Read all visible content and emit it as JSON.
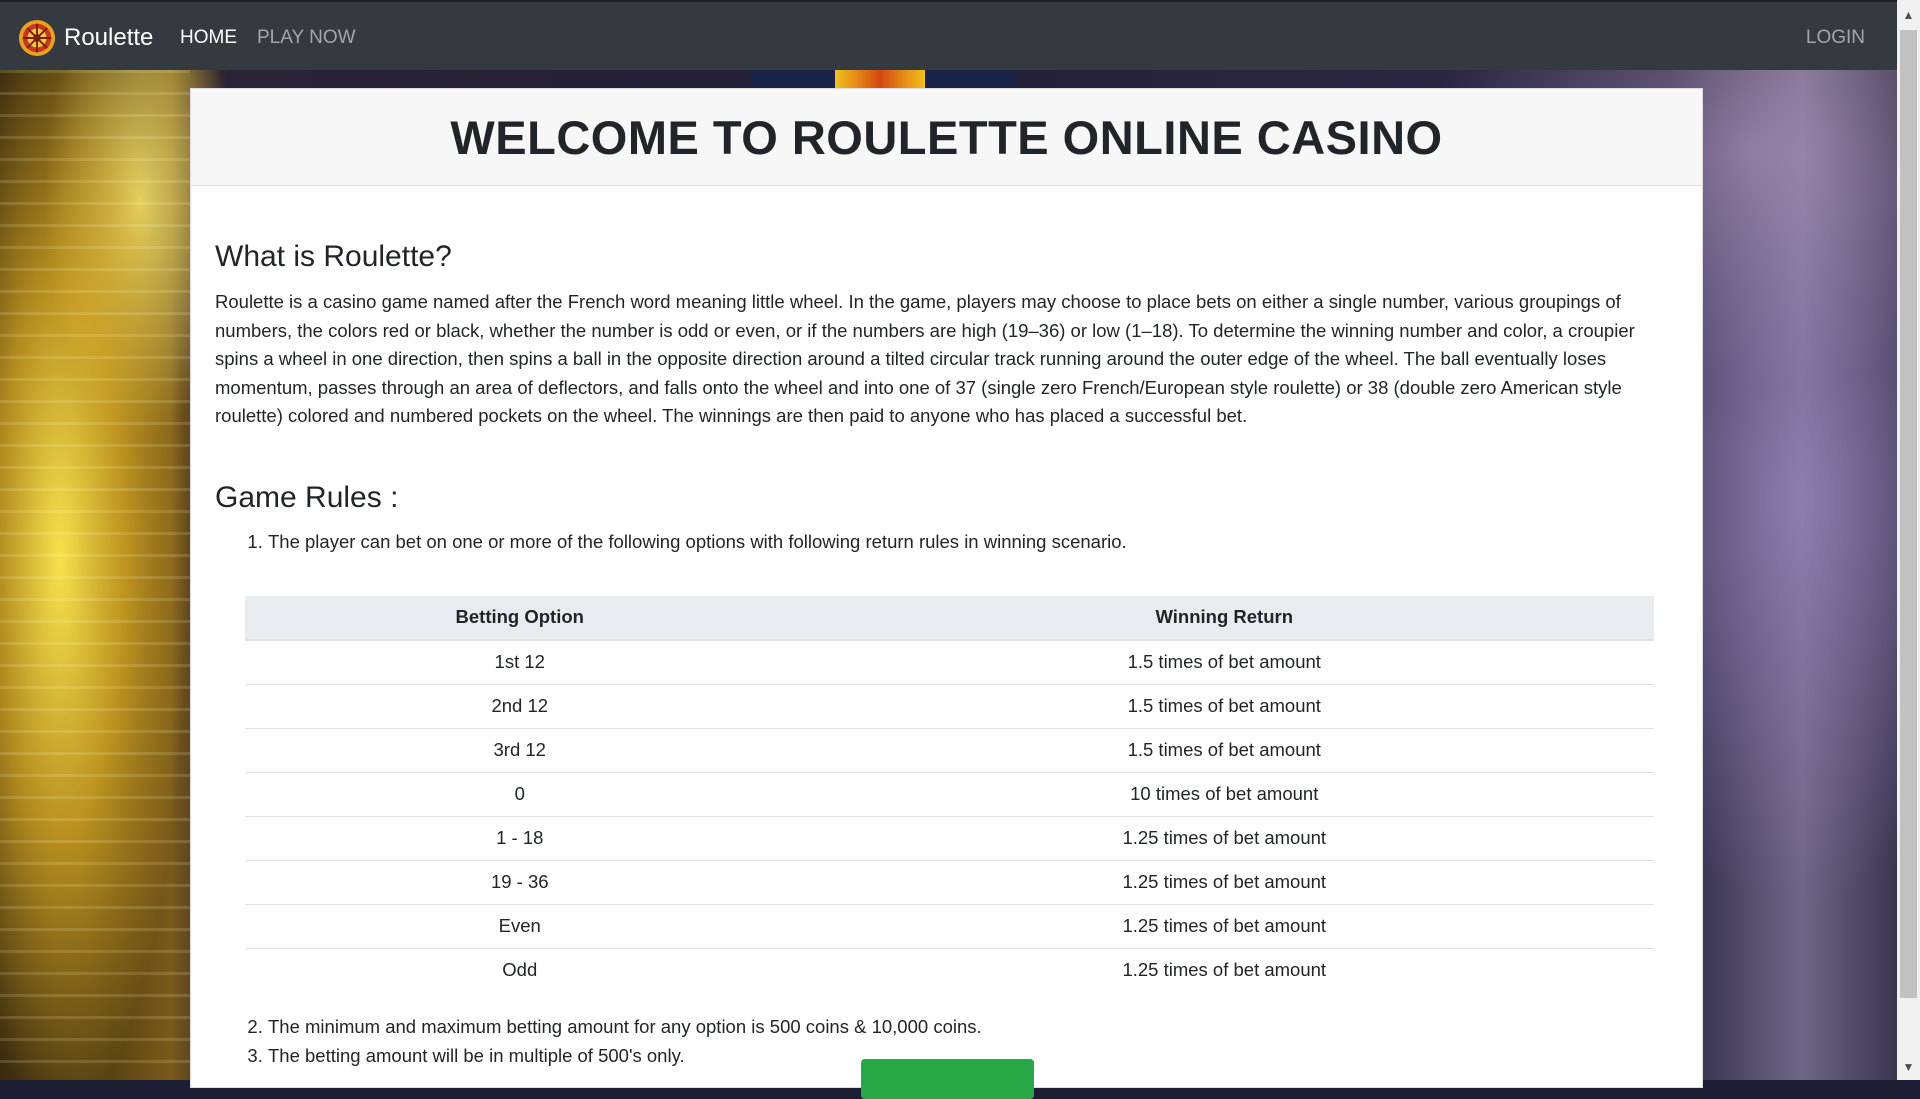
{
  "nav": {
    "brand": "Roulette",
    "links": [
      "HOME",
      "PLAY NOW"
    ],
    "login": "LOGIN"
  },
  "card": {
    "title": "WELCOME TO ROULETTE ONLINE CASINO"
  },
  "about": {
    "heading": "What is Roulette?",
    "text": "Roulette is a casino game named after the French word meaning little wheel. In the game, players may choose to place bets on either a single number, various groupings of numbers, the colors red or black, whether the number is odd or even, or if the numbers are high (19–36) or low (1–18). To determine the winning number and color, a croupier spins a wheel in one direction, then spins a ball in the opposite direction around a tilted circular track running around the outer edge of the wheel. The ball eventually loses momentum, passes through an area of deflectors, and falls onto the wheel and into one of 37 (single zero French/European style roulette) or 38 (double zero American style roulette) colored and numbered pockets on the wheel. The winnings are then paid to anyone who has placed a successful bet."
  },
  "rules": {
    "heading": "Game Rules :",
    "items": [
      "The player can bet on one or more of the following options with following return rules in winning scenario.",
      "The minimum and maximum betting amount for any option is 500 coins & 10,000 coins.",
      "The betting amount will be in multiple of 500's only."
    ],
    "table": {
      "headers": [
        "Betting Option",
        "Winning Return"
      ],
      "rows": [
        [
          "1st 12",
          "1.5 times of bet amount"
        ],
        [
          "2nd 12",
          "1.5 times of bet amount"
        ],
        [
          "3rd 12",
          "1.5 times of bet amount"
        ],
        [
          "0",
          "10 times of bet amount"
        ],
        [
          "1 - 18",
          "1.25 times of bet amount"
        ],
        [
          "19 - 36",
          "1.25 times of bet amount"
        ],
        [
          "Even",
          "1.25 times of bet amount"
        ],
        [
          "Odd",
          "1.25 times of bet amount"
        ]
      ]
    }
  },
  "icons": {
    "brand": "roulette-wheel-icon",
    "scroll_up": "arrow-up-icon",
    "scroll_down": "arrow-down-icon"
  },
  "colors": {
    "navbar": "#343a40",
    "accent_button": "#28a745"
  }
}
